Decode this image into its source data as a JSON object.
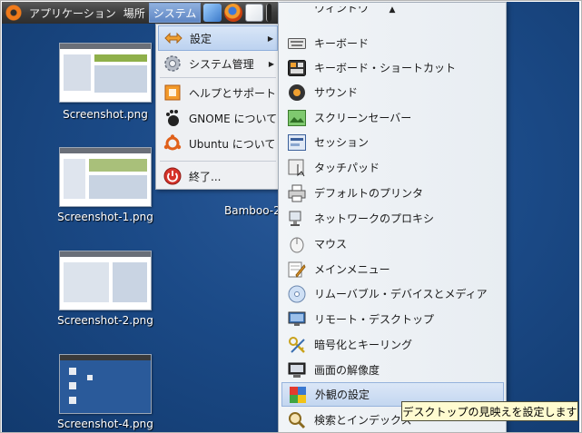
{
  "top_panel": {
    "applications_label": "アプリケーション",
    "places_label": "場所",
    "system_label": "システム"
  },
  "desktop": {
    "icons": [
      {
        "label": "Screenshot.png"
      },
      {
        "label": "Screenshot-1.png"
      },
      {
        "label": "Screenshot-2.png"
      },
      {
        "label": "Screenshot-4.png"
      }
    ],
    "partial_label": "Bamboo-2"
  },
  "system_menu": {
    "items": [
      {
        "label": "設定",
        "icon": "preferences-icon"
      },
      {
        "label": "システム管理",
        "icon": "administration-gear-icon"
      },
      {
        "label": "ヘルプとサポート",
        "icon": "help-icon"
      },
      {
        "label": "GNOME について",
        "icon": "gnome-foot-icon"
      },
      {
        "label": "Ubuntu について",
        "icon": "ubuntu-logo-icon"
      },
      {
        "label": "終了...",
        "icon": "power-icon"
      }
    ]
  },
  "settings_menu": {
    "partial_top_label": "ウィンドウ",
    "items": [
      {
        "label": "キーボード",
        "icon": "keyboard-icon"
      },
      {
        "label": "キーボード・ショートカット",
        "icon": "keyboard-shortcuts-icon"
      },
      {
        "label": "サウンド",
        "icon": "sound-icon"
      },
      {
        "label": "スクリーンセーバー",
        "icon": "screensaver-icon"
      },
      {
        "label": "セッション",
        "icon": "session-icon"
      },
      {
        "label": "タッチパッド",
        "icon": "touchpad-icon"
      },
      {
        "label": "デフォルトのプリンタ",
        "icon": "printer-icon"
      },
      {
        "label": "ネットワークのプロキシ",
        "icon": "network-proxy-icon"
      },
      {
        "label": "マウス",
        "icon": "mouse-icon"
      },
      {
        "label": "メインメニュー",
        "icon": "main-menu-icon"
      },
      {
        "label": "リムーバブル・デバイスとメディア",
        "icon": "removable-media-icon"
      },
      {
        "label": "リモート・デスクトップ",
        "icon": "remote-desktop-icon"
      },
      {
        "label": "暗号化とキーリング",
        "icon": "encryption-keyring-icon"
      },
      {
        "label": "画面の解像度",
        "icon": "display-resolution-icon"
      },
      {
        "label": "外観の設定",
        "icon": "appearance-icon"
      },
      {
        "label": "検索とインデックス",
        "icon": "search-index-icon"
      }
    ]
  },
  "tooltip": {
    "text": "デスクトップの見映えを設定します"
  },
  "colors": {
    "desktop_bg": "#1b4a87",
    "panel_bg": "#3c3c3c",
    "highlight": "#c3d6f0",
    "tooltip_bg": "#fffbd0"
  }
}
